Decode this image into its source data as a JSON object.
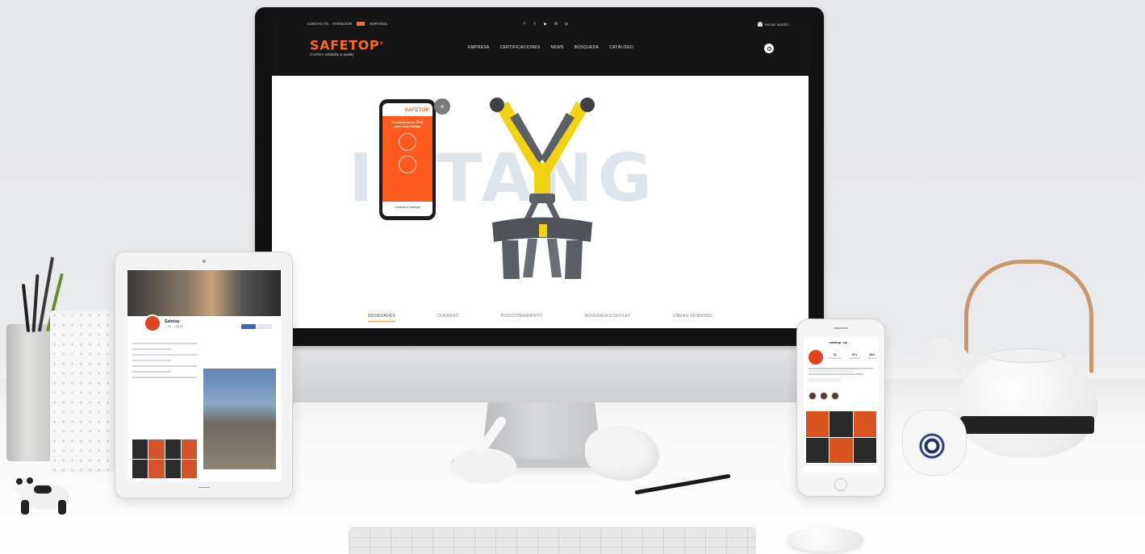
{
  "site": {
    "topbar": {
      "left_text": "CONTACTO · ATENCION",
      "language": "ESPAÑOL",
      "social_icons": [
        "facebook-icon",
        "twitter-icon",
        "youtube-icon",
        "mail-icon",
        "instagram-icon"
      ],
      "social_glyphs": [
        "f",
        "t",
        "▶",
        "✉",
        "◎"
      ],
      "account_label": "Iniciar sesión"
    },
    "logo": {
      "word": "SAFETOP",
      "mark": "®",
      "tagline": "Comfort, reliability & quality"
    },
    "nav": [
      "EMPRESA",
      "CERTIFICACIONES",
      "NEWS",
      "BÚSQUEDA",
      "CATÁLOGO"
    ],
    "hero": {
      "background_word": "IUTANG",
      "phone_promo": {
        "brand": "SAFETOP",
        "title": "Certificaciones EPIS\npara cada trabajo",
        "footer": "Consulta el catálogo"
      },
      "close_glyph": "×"
    },
    "tabs": [
      "NOVEDADES",
      "CUERDAS",
      "POSICIONAMIENTO",
      "NOVEDADES OUTLET",
      "LÍNEAS VENDIDAS"
    ]
  },
  "tablet": {
    "page_name": "Safetop",
    "phone_line": "— 81 — 54 28"
  },
  "phone": {
    "username": "safetop_epi",
    "stats": [
      {
        "value": "71",
        "label": "publicaciones"
      },
      {
        "value": "371",
        "label": "seguidores"
      },
      {
        "value": "104",
        "label": "seguidos"
      }
    ]
  },
  "colors": {
    "brand_orange": "#ff6a13",
    "header_dark": "#151515",
    "harness_yellow": "#f2d312",
    "harness_grey": "#5b5f66",
    "tab_underline": "#ff9a2e"
  }
}
